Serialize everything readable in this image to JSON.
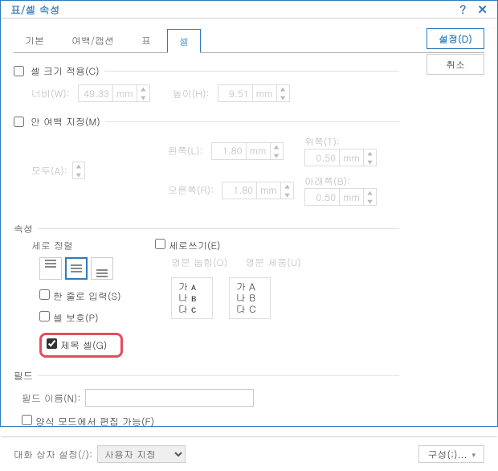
{
  "title": "표/셀 속성",
  "buttons": {
    "ok": "설정(D)",
    "cancel": "취소"
  },
  "tabs": [
    "기본",
    "여백/캡션",
    "표",
    "셀"
  ],
  "activeTab": 3,
  "cellSize": {
    "label": "셀 크기 적용(C)",
    "width": {
      "label": "너비(W):",
      "value": "49.33",
      "unit": "mm"
    },
    "height": {
      "label": "높이(H):",
      "value": "9.51",
      "unit": "mm"
    }
  },
  "innerMargin": {
    "label": "안 여백 지정(M)",
    "left": {
      "label": "왼쪽(L):",
      "value": "1.80",
      "unit": "mm"
    },
    "right": {
      "label": "오른쪽(R):",
      "value": "1.80",
      "unit": "mm"
    },
    "top": {
      "label": "위쪽(T):",
      "value": "0.50",
      "unit": "mm"
    },
    "bottom": {
      "label": "아래쪽(B):",
      "value": "0.50",
      "unit": "mm"
    },
    "all": "모두(A):"
  },
  "attrs": {
    "title": "속성",
    "valign": "세로 정렬",
    "vertWrite": "세로쓰기(E)",
    "engStack": "영문 눕힘(O)",
    "engUpright": "영문 세움(U)",
    "stackSample": [
      "가",
      "나",
      "다"
    ],
    "oneLine": "한 줄로 입력(S)",
    "protect": "셀 보호(P)",
    "headerCell": "제목 셀(G)"
  },
  "field": {
    "title": "필드",
    "name": "필드 이름(N):",
    "value": "",
    "editable": "양식 모드에서 편집 가능(F)"
  },
  "dialog": {
    "setting": "대화 상자 설정(/):",
    "selected": "사용자 지정",
    "config": "구성(;)..."
  }
}
